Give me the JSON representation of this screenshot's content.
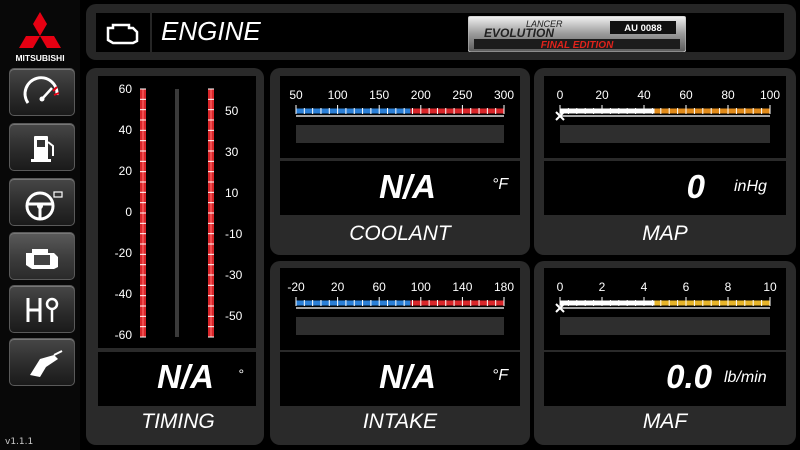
{
  "app": {
    "brand": "MITSUBISHI",
    "version": "v1.1.1"
  },
  "colors": {
    "logo_red": "#e60012",
    "panel_bg": "#2a2a2a",
    "bar_blue": "#2b7fd6",
    "bar_red": "#d8262a",
    "bar_orange": "#e08a1a",
    "bar_yellow": "#e6b42a"
  },
  "sidebar": {
    "items": [
      {
        "icon": "speedometer-icon",
        "active": false
      },
      {
        "icon": "fuel-pump-icon",
        "active": false
      },
      {
        "icon": "steering-wheel-icon",
        "active": false
      },
      {
        "icon": "engine-icon",
        "active": true
      },
      {
        "icon": "gear-shift-icon",
        "active": false
      },
      {
        "icon": "fuel-nozzle-icon",
        "active": false
      }
    ]
  },
  "header": {
    "icon": "engine-icon",
    "title": "ENGINE",
    "badge": {
      "line1": "LANCER",
      "line2": "EVOLUTION",
      "line3": "FINAL EDITION",
      "plate": "AU 0088"
    }
  },
  "timing": {
    "label": "TIMING",
    "value": "N/A",
    "unit": "°",
    "left_scale": [
      "60",
      "40",
      "20",
      "0",
      "-20",
      "-40",
      "-60"
    ],
    "right_scale": [
      "50",
      "30",
      "10",
      "-10",
      "-30",
      "-50"
    ]
  },
  "coolant": {
    "label": "COOLANT",
    "value": "N/A",
    "unit": "°F",
    "scale": [
      "50",
      "100",
      "150",
      "200",
      "250",
      "300"
    ]
  },
  "map": {
    "label": "MAP",
    "value": "0",
    "unit": "inHg",
    "scale": [
      "0",
      "20",
      "40",
      "60",
      "80",
      "100"
    ]
  },
  "intake": {
    "label": "INTAKE",
    "value": "N/A",
    "unit": "°F",
    "scale": [
      "-20",
      "20",
      "60",
      "100",
      "140",
      "180"
    ]
  },
  "maf": {
    "label": "MAF",
    "value": "0.0",
    "unit": "lb/min",
    "scale": [
      "0",
      "2",
      "4",
      "6",
      "8",
      "10"
    ]
  }
}
